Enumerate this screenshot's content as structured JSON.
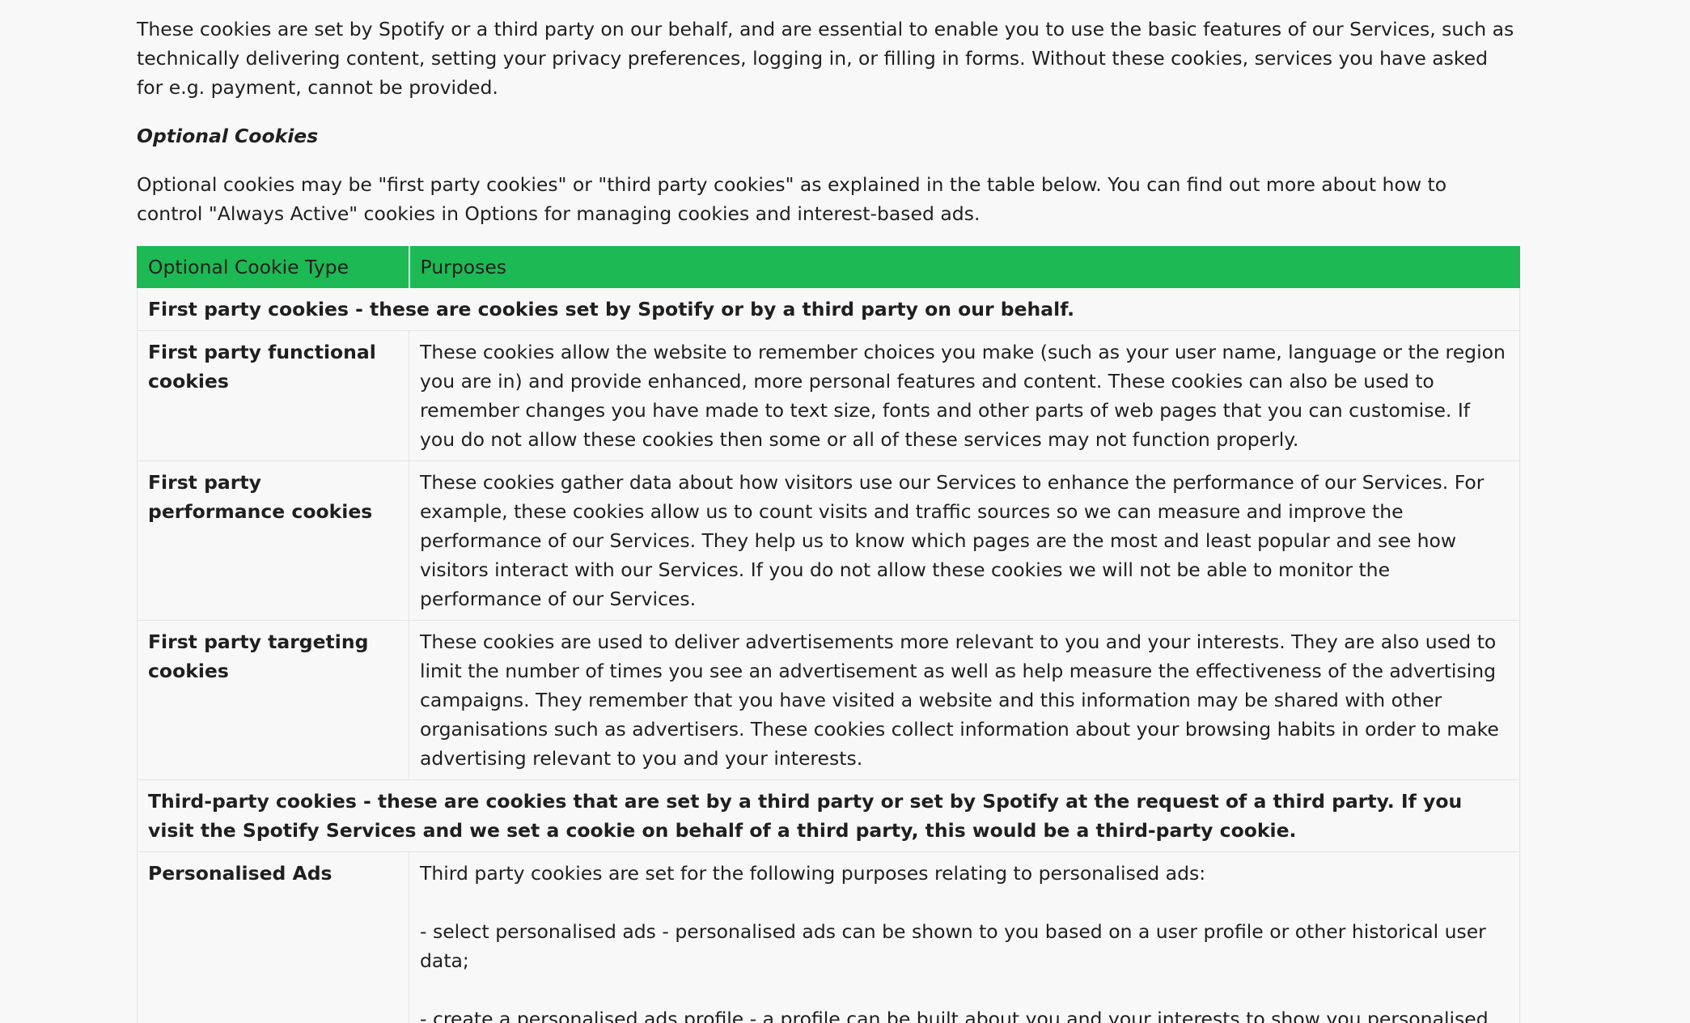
{
  "intro": {
    "essential_paragraph": "These cookies are set by Spotify or a third party on our behalf, and are essential to enable you to use the basic features of our Services, such as technically delivering content, setting your privacy preferences, logging in, or filling in forms. Without these cookies, services you have asked for e.g. payment, cannot be provided.",
    "optional_heading": "Optional Cookies",
    "optional_paragraph": "Optional cookies may be \"first party cookies\" or \"third party cookies\" as explained in the table below. You can find out more about how to control \"Always Active\" cookies in Options for managing cookies and interest-based ads."
  },
  "table": {
    "header_color": "#1db954",
    "headers": {
      "type": "Optional Cookie Type",
      "purposes": "Purposes"
    },
    "first_party_section": "First party cookies - these are cookies set by Spotify or by a third party on our behalf.",
    "rows": [
      {
        "type": "First party functional cookies",
        "purpose": "These cookies allow the website to remember choices you make (such as your user name, language or the region you are in) and provide enhanced, more personal features and content. These cookies can also be used to remember changes you have made to text size, fonts and other parts of web pages that you can customise. If you do not allow these cookies then some or all of these services may not function properly."
      },
      {
        "type": "First party performance cookies",
        "purpose": "These cookies gather data about how visitors use our Services to enhance the performance of our Services. For example, these cookies allow us to count visits and traffic sources so we can measure and improve the performance of our Services. They help us to know which pages are the most and least popular and see how visitors interact with our Services. If you do not allow these cookies we will not be able to monitor the performance of our Services."
      },
      {
        "type": "First party targeting cookies",
        "purpose": "These cookies are used to deliver advertisements more relevant to you and your interests. They are also used to limit the number of times you see an advertisement as well as help measure the effectiveness of the advertising campaigns. They remember that you have visited a website and this information may be shared with other organisations such as advertisers. These cookies collect information about your browsing habits in order to make advertising relevant to you and your interests."
      }
    ],
    "third_party_section": "Third-party cookies - these are cookies that are set by a third party or set by Spotify at the request of a third party. If you visit the Spotify Services and we set a cookie on behalf of a third party, this would be a third-party cookie.",
    "personalised_ads": {
      "type": "Personalised Ads",
      "intro": "Third party cookies are set for the following purposes relating to personalised ads:",
      "item1": "- select personalised ads - personalised ads can be shown to you based on a user profile or other historical user data;",
      "item2": "- create a personalised ads profile - a profile can be built about you and your interests to show you personalised ads that are relevant to you; and"
    }
  }
}
